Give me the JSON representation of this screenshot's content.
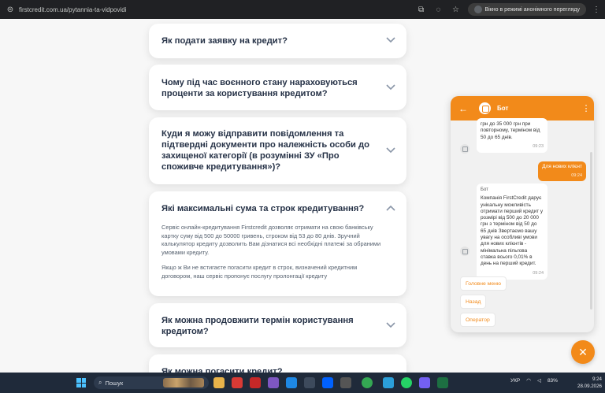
{
  "browser": {
    "url": "firstcredit.com.ua/pytannia-ta-vidpovidi",
    "incognito_label": "Вікно в режимі анонімного перегляду"
  },
  "faq": {
    "items": [
      {
        "question": "Як подати заявку на кредит?",
        "expanded": false
      },
      {
        "question": "Чому під час воєнного стану нараховуються проценти за користування кредитом?",
        "expanded": false
      },
      {
        "question": "Куди я можу відправити повідомлення та підтвердні документи про належність особи до захищеної категорії (в розумінні ЗУ «Про споживче кредитування»)?",
        "expanded": false
      },
      {
        "question": "Які максимальні сума та строк кредитування?",
        "expanded": true,
        "answer_1": "Сервіс онлайн-кредитування Firstcredit дозволяє отримати на свою банківську картку суму від 500 до 50000 гривень, строком від 53 до 80 днів. Зручний калькулятор кредиту дозволить Вам дізнатися всі необхідні платежі за обраними умовами кредиту.",
        "answer_2": "Якщо ж Ви не встигаєте погасити кредит в строк, визначений кредитним договором, наш сервіс пропонує послугу пролонгації кредиту"
      },
      {
        "question": "Як можна продовжити термін користування кредитом?",
        "expanded": false
      },
      {
        "question": "Як можна погасити кредит?",
        "expanded": false
      }
    ]
  },
  "chat": {
    "title": "Бот",
    "messages": [
      {
        "from": "bot",
        "text": "грн до 35 000 грн при повторному, терміном від 50 до 65 днів.",
        "time": "09:23"
      },
      {
        "from": "user",
        "text": "Для нових клієнт",
        "time": "09:24"
      },
      {
        "from": "bot",
        "sender": "Бот",
        "text": "Компанія FirstCredit дарує унікальну можливість отримати перший кредит у розмірі від 500 до 20 000 грн з терміном від 50 до 65 днів Звертаємо вашу увагу на особливі умови для нових клієнтів - мінімальна пільгова ставка всього 0,01% в день на перший кредит.",
        "time": "09:24"
      }
    ],
    "buttons": [
      "Головне меню",
      "Назад",
      "Оператор"
    ]
  },
  "taskbar": {
    "search_placeholder": "Пошук",
    "language": "УКР",
    "battery": "83%",
    "time": "9:24",
    "date": "28.09.2026"
  },
  "colors": {
    "accent": "#f28a1a",
    "question_text": "#263247"
  },
  "icons": {
    "chevron": "chevron-down-icon",
    "chat_close": "close-icon"
  }
}
